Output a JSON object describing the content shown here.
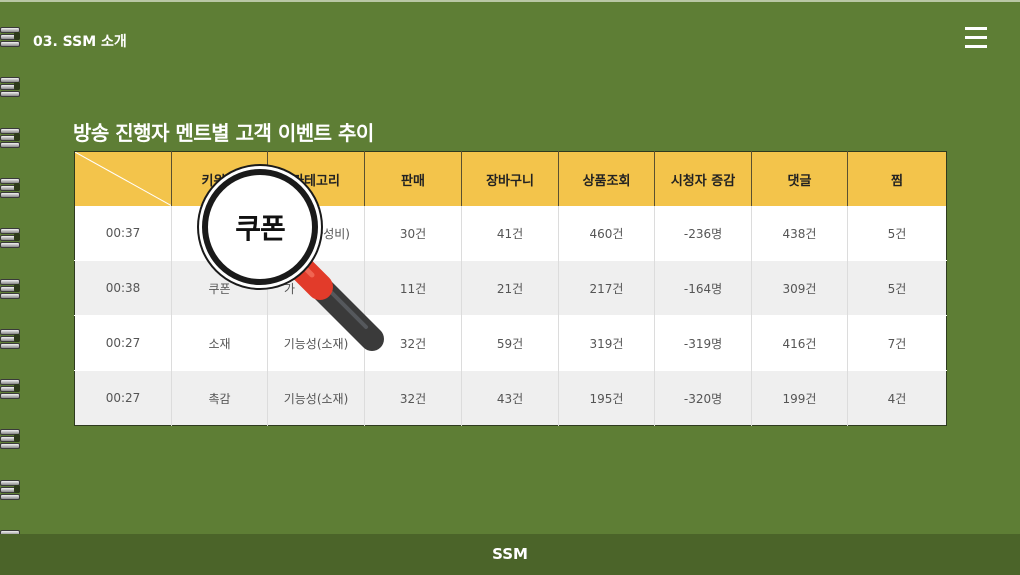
{
  "header": {
    "section_label": "03. SSM 소개"
  },
  "slide": {
    "title": "방송 진행자 멘트별 고객 이벤트 추이"
  },
  "table": {
    "columns": [
      "",
      "키워드",
      "카테고리",
      "판매",
      "장바구니",
      "상품조회",
      "시청자 증감",
      "댓글",
      "찜"
    ],
    "rows": [
      [
        "00:37",
        "",
        "가성비)",
        "30건",
        "41건",
        "460건",
        "-236명",
        "438건",
        "5건"
      ],
      [
        "00:38",
        "쿠폰",
        "가",
        "11건",
        "21건",
        "217건",
        "-164명",
        "309건",
        "5건"
      ],
      [
        "00:27",
        "소재",
        "기능성(소재)",
        "32건",
        "59건",
        "319건",
        "-319명",
        "416건",
        "7건"
      ],
      [
        "00:27",
        "촉감",
        "기능성(소재)",
        "32건",
        "43건",
        "195건",
        "-320명",
        "199건",
        "4건"
      ]
    ]
  },
  "magnifier": {
    "lens_text": "쿠폰",
    "handle_color": "#3a3a3a",
    "collar_color": "#e23b2a"
  },
  "footer": {
    "label": "SSM"
  },
  "colors": {
    "background": "#5e7e35",
    "header_row": "#f3c44b",
    "footer": "#4b6429"
  }
}
